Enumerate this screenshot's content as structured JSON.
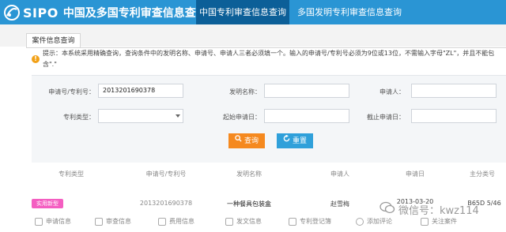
{
  "header": {
    "logo_text": "SIPO",
    "site_title": "中国及多国专利审查信息查询",
    "tabs": [
      {
        "label": "中国专利审查信息查询"
      },
      {
        "label": "多国发明专利审查信息查询"
      }
    ],
    "colors": {
      "bar": "#2a95d4",
      "active_tab": "#0c5f98"
    }
  },
  "subtab": {
    "label": "案件信息查询"
  },
  "notice": {
    "text": "提示：本系统采用精确查询，查询条件中的发明名称、申请号、申请人三者必须填一个。输入的申请号/专利号必须为9位或13位，不需输入字母\"ZL\"，并且不能包含\".\""
  },
  "form": {
    "app_no_label": "申请号/专利号：",
    "app_no_value": "2013201690378",
    "invention_name_label": "发明名称：",
    "invention_name_value": "",
    "applicant_label": "申请人：",
    "applicant_value": "",
    "patent_type_label": "专利类型：",
    "patent_type_value": "",
    "start_date_label": "起始申请日：",
    "start_date_value": "",
    "end_date_label": "截止申请日：",
    "end_date_value": "",
    "query_button": "查询",
    "reset_button": "重置",
    "colors": {
      "query": "#f5891f",
      "reset": "#2fa0da"
    }
  },
  "table": {
    "headers": [
      "专利类型",
      "申请号/专利号",
      "发明名称",
      "申请人",
      "申请日",
      "主分类号"
    ],
    "rows": [
      {
        "type": "实用新型",
        "app_no": "2013201690378",
        "name": "一种餐具包装盒",
        "applicant": "赵雪梅",
        "date": "2013-03-20",
        "class": "B65D 5/46"
      }
    ],
    "badge_color": "#f45ec1"
  },
  "actions": [
    "申请信息",
    "审查信息",
    "费用信息",
    "发文信息",
    "专利登记簿",
    "添加评论",
    "关注案件"
  ],
  "watermark": {
    "text": "微信号：kwz114"
  }
}
